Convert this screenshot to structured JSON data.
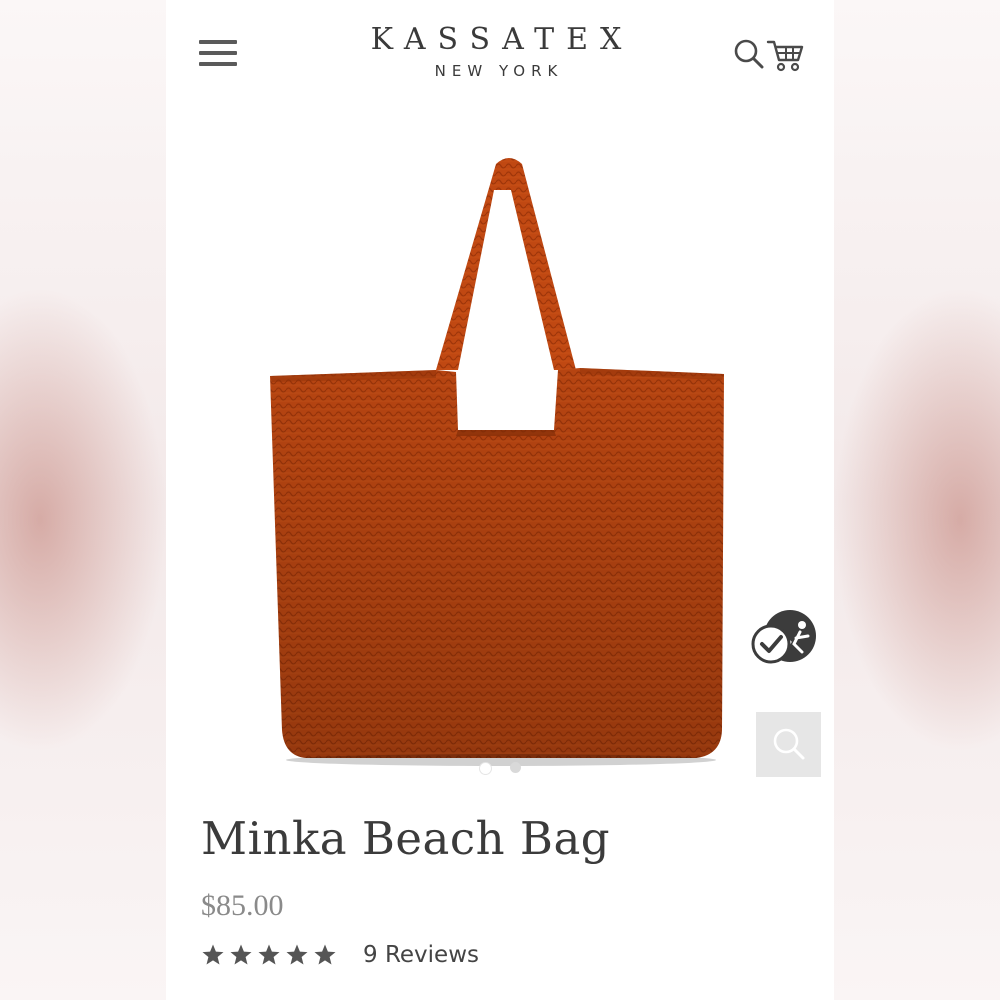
{
  "brand": {
    "name": "KASSATEX",
    "sub": "NEW YORK"
  },
  "header": {
    "menu_icon": "hamburger-menu-icon",
    "search_icon": "search-icon",
    "cart_icon": "shopping-cart-icon"
  },
  "product": {
    "title": "Minka Beach Bag",
    "price": "$85.00",
    "rating": 5,
    "rating_max": 5,
    "reviews_label": "9 Reviews",
    "image_count": 2,
    "active_image": 1,
    "image_icon": "orange-woven-tote-bag",
    "verified_badge_icon": "verified-checkmark-badge-icon",
    "zoom_icon": "zoom-search-icon"
  },
  "colors": {
    "text_dark": "#3b3b3b",
    "price_gray": "#8a8a8a",
    "bag_orange": "#c24a12",
    "star_gray": "#555555"
  }
}
